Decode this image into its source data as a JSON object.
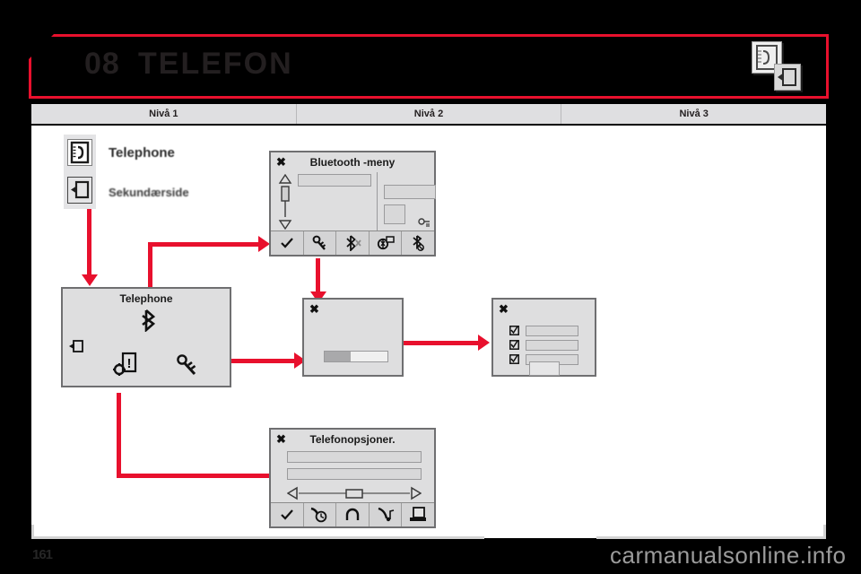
{
  "header": {
    "chapter_number": "08",
    "title": "TELEFON",
    "icons": [
      "telephone-card-icon",
      "enter-arrow-icon"
    ],
    "accent_color": "#e8102d"
  },
  "levels": [
    {
      "label": "Nivå 1"
    },
    {
      "label": "Nivå 2"
    },
    {
      "label": "Nivå 3"
    }
  ],
  "legend": {
    "primary_label": "Telephone",
    "secondary_label": "Sekundærside",
    "primary_icon": "telephone-card-icon",
    "secondary_icon": "enter-arrow-icon"
  },
  "panels": {
    "bluetooth_menu": {
      "title": "Bluetooth -meny",
      "close_icon": "close-x-icon",
      "scrollbar_icons": [
        "triangle-up-icon",
        "scroll-thumb",
        "triangle-down-icon"
      ],
      "toolbar_icons": [
        "check-icon",
        "key-search-icon",
        "bluetooth-off-icon",
        "bluetooth-card-icon",
        "bluetooth-cancel-icon"
      ]
    },
    "telephone_home": {
      "title": "Telephone",
      "icons": [
        "bluetooth-icon",
        "enter-arrow-icon",
        "gear-phone-icon",
        "key-search-icon"
      ]
    },
    "progress": {
      "close_icon": "close-x-icon",
      "progress_percent": 42
    },
    "pairing_list": {
      "close_icon": "close-x-icon",
      "rows": [
        {
          "checkbox_icon": "checked-box-icon"
        },
        {
          "checkbox_icon": "checked-box-icon"
        },
        {
          "checkbox_icon": "checked-box-icon"
        }
      ],
      "button_label": ""
    },
    "phone_options": {
      "title": "Telefonopsjoner.",
      "close_icon": "close-x-icon",
      "slider": {
        "left_icon": "triangle-left-icon",
        "right_icon": "triangle-right-icon",
        "value_percent": 50
      },
      "toolbar_icons": [
        "check-icon",
        "phone-clock-icon",
        "headset-icon",
        "phone-music-icon",
        "computer-icon"
      ]
    }
  },
  "footer": {
    "page_number": "161",
    "watermark": "carmanualsonline.info"
  }
}
